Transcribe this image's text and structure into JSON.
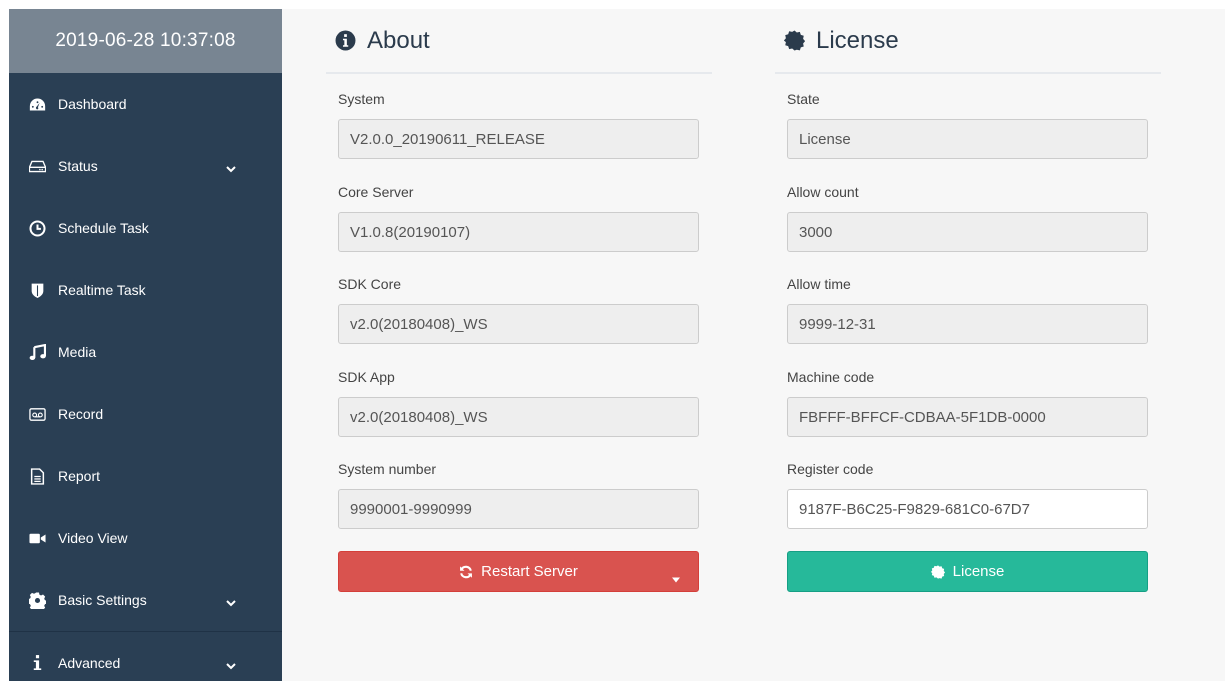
{
  "sidebar": {
    "datetime": "2019-06-28 10:37:08",
    "items": [
      {
        "label": "Dashboard",
        "icon": "tachometer-icon"
      },
      {
        "label": "Status",
        "icon": "hdd-icon"
      },
      {
        "label": "Schedule Task",
        "icon": "clock-icon"
      },
      {
        "label": "Realtime Task",
        "icon": "shield-icon"
      },
      {
        "label": "Media",
        "icon": "music-icon"
      },
      {
        "label": "Record",
        "icon": "voicemail-icon"
      },
      {
        "label": "Report",
        "icon": "file-text-icon"
      },
      {
        "label": "Video View",
        "icon": "video-camera-icon"
      },
      {
        "label": "Basic Settings",
        "icon": "gear-icon"
      },
      {
        "label": "Advanced",
        "icon": "info-icon"
      }
    ]
  },
  "about": {
    "title": "About",
    "icon": "info-circle-icon",
    "fields": [
      {
        "label": "System",
        "value": "V2.0.0_20190611_RELEASE"
      },
      {
        "label": "Core Server",
        "value": "V1.0.8(20190107)"
      },
      {
        "label": "SDK Core",
        "value": "v2.0(20180408)_WS"
      },
      {
        "label": "SDK App",
        "value": "v2.0(20180408)_WS"
      },
      {
        "label": "System number",
        "value": "9990001-9990999"
      }
    ],
    "restart_label": "Restart Server"
  },
  "license": {
    "title": "License",
    "icon": "certificate-icon",
    "fields": [
      {
        "label": "State",
        "value": "License"
      },
      {
        "label": "Allow count",
        "value": "3000"
      },
      {
        "label": "Allow time",
        "value": "9999-12-31"
      },
      {
        "label": "Machine code",
        "value": "FBFFF-BFFCF-CDBAA-5F1DB-0000"
      },
      {
        "label": "Register code",
        "value": "9187F-B6C25-F9829-681C0-67D7"
      }
    ],
    "license_button_label": "License"
  },
  "colors": {
    "sidebar_bg": "#2a3f54",
    "datetime_bg": "#788592",
    "danger": "#d9534f",
    "success": "#26b99a"
  }
}
